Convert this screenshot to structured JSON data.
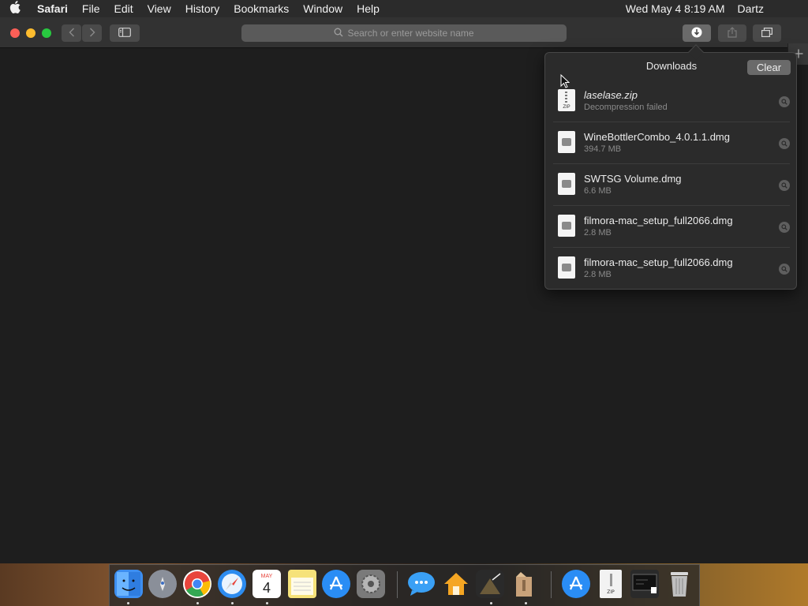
{
  "menubar": {
    "app_name": "Safari",
    "menus": [
      "File",
      "Edit",
      "View",
      "History",
      "Bookmarks",
      "Window",
      "Help"
    ],
    "datetime": "Wed May 4  8:19 AM",
    "user": "Dartz"
  },
  "toolbar": {
    "address_placeholder": "Search or enter website name"
  },
  "downloads": {
    "title": "Downloads",
    "clear_label": "Clear",
    "items": [
      {
        "name": "laselase.zip",
        "detail": "Decompression failed",
        "kind": "zip"
      },
      {
        "name": "WineBottlerCombo_4.0.1.1.dmg",
        "detail": "394.7 MB",
        "kind": "dmg"
      },
      {
        "name": "SWTSG Volume.dmg",
        "detail": "6.6 MB",
        "kind": "dmg"
      },
      {
        "name": "filmora-mac_setup_full2066.dmg",
        "detail": "2.8 MB",
        "kind": "dmg"
      },
      {
        "name": "filmora-mac_setup_full2066.dmg",
        "detail": "2.8 MB",
        "kind": "dmg"
      }
    ],
    "zip_label": "ZIP"
  },
  "dock": {
    "calendar_month": "MAY",
    "calendar_day": "4",
    "items": [
      {
        "name": "finder-icon",
        "color": "#3d8ef0"
      },
      {
        "name": "launchpad-icon",
        "color": "#8a8f99"
      },
      {
        "name": "chrome-icon",
        "color": "#e8453c"
      },
      {
        "name": "safari-icon",
        "color": "#2d8cf0"
      },
      {
        "name": "calendar-icon",
        "color": "#ffffff"
      },
      {
        "name": "notes-icon",
        "color": "#f6e27a"
      },
      {
        "name": "app-store-icon",
        "color": "#2a8df5"
      },
      {
        "name": "system-preferences-icon",
        "color": "#7a7a7a"
      },
      {
        "name": "messages-icon",
        "color": "#3aa0f5"
      },
      {
        "name": "home-icon",
        "color": "#f5a623"
      },
      {
        "name": "rosetta-stone-icon",
        "color": "#333333"
      },
      {
        "name": "unarchiver-icon",
        "color": "#c9a27a"
      },
      {
        "name": "app-store-folder-icon",
        "color": "#2a8df5"
      },
      {
        "name": "zip-file-icon",
        "color": "#f2f2f2"
      },
      {
        "name": "screen-recording-icon",
        "color": "#2a2a2a"
      },
      {
        "name": "trash-icon",
        "color": "#bfbfbf"
      }
    ]
  }
}
